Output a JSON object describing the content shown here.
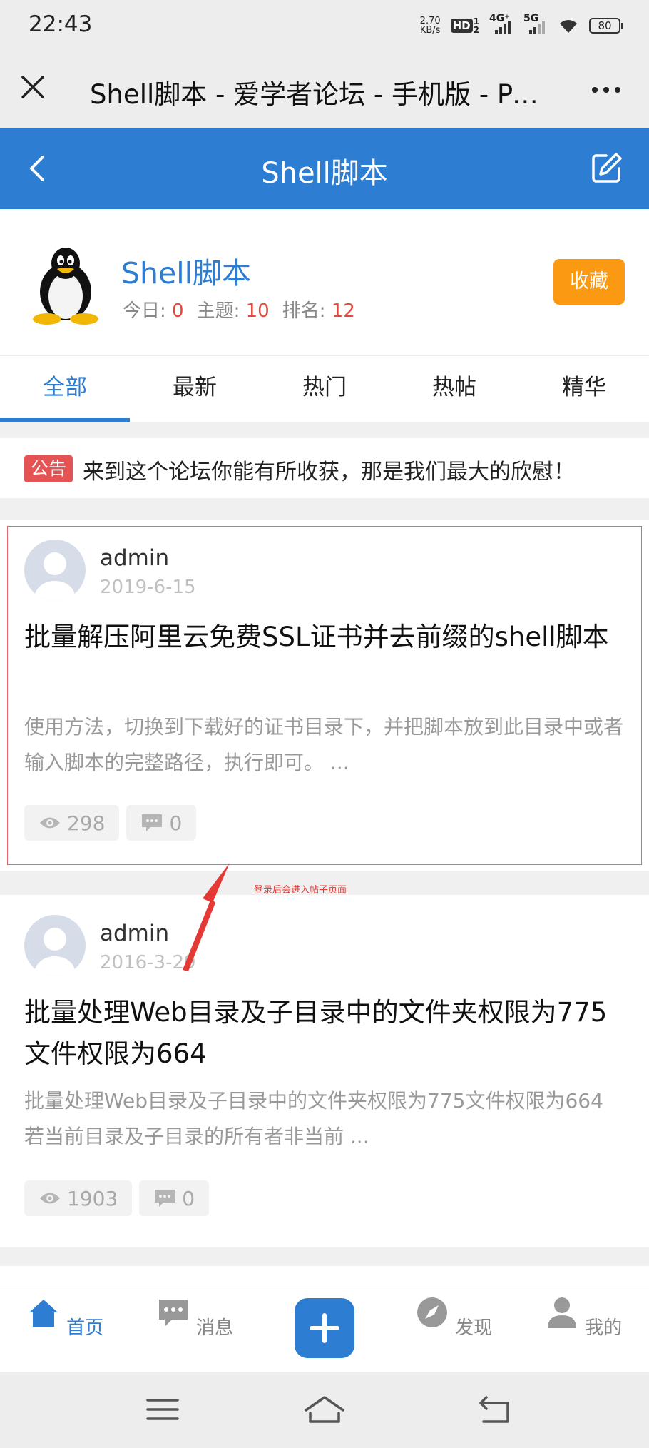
{
  "status_bar": {
    "time": "22:43",
    "net_speed_value": "2.70",
    "net_speed_unit": "KB/s",
    "hd_label": "HD",
    "hd_sup": "1",
    "hd_sub": "2",
    "signal1_label": "4G⁺",
    "signal2_label": "5G",
    "battery": "80"
  },
  "browser": {
    "title": "Shell脚本 - 爱学者论坛 - 手机版 - Powered by Discuz!"
  },
  "header": {
    "title": "Shell脚本"
  },
  "forum": {
    "name": "Shell脚本",
    "today_label": "今日:",
    "today_value": "0",
    "topics_label": "主题:",
    "topics_value": "10",
    "rank_label": "排名:",
    "rank_value": "12",
    "favorite_button": "收藏"
  },
  "tabs": [
    {
      "label": "全部",
      "active": true
    },
    {
      "label": "最新",
      "active": false
    },
    {
      "label": "热门",
      "active": false
    },
    {
      "label": "热帖",
      "active": false
    },
    {
      "label": "精华",
      "active": false
    }
  ],
  "notice": {
    "badge": "公告",
    "text": "来到这个论坛你能有所收获，那是我们最大的欣慰！"
  },
  "posts": [
    {
      "author": "admin",
      "date": "2019-6-15",
      "title": "批量解压阿里云免费SSL证书并去前缀的shell脚本",
      "summary": "使用方法，切换到下载好的证书目录下，并把脚本放到此目录中或者输入脚本的完整路径，执行即可。 ...",
      "views": "298",
      "replies": "0"
    },
    {
      "author": "admin",
      "date": "2016-3-29",
      "title": "批量处理Web目录及子目录中的文件夹权限为775文件权限为664",
      "summary": "批量处理Web目录及子目录中的文件夹权限为775文件权限为664 若当前目录及子目录的所有者非当前 ...",
      "views": "1903",
      "replies": "0"
    }
  ],
  "annotation": "登录后会进入帖子页面",
  "bottom_nav": {
    "home": "首页",
    "messages": "消息",
    "discover": "发现",
    "me": "我的"
  },
  "colors": {
    "primary": "#2d7dd2",
    "favorite": "#fb9a12",
    "notice_badge": "#e55454",
    "stat_number": "#e4483e"
  }
}
